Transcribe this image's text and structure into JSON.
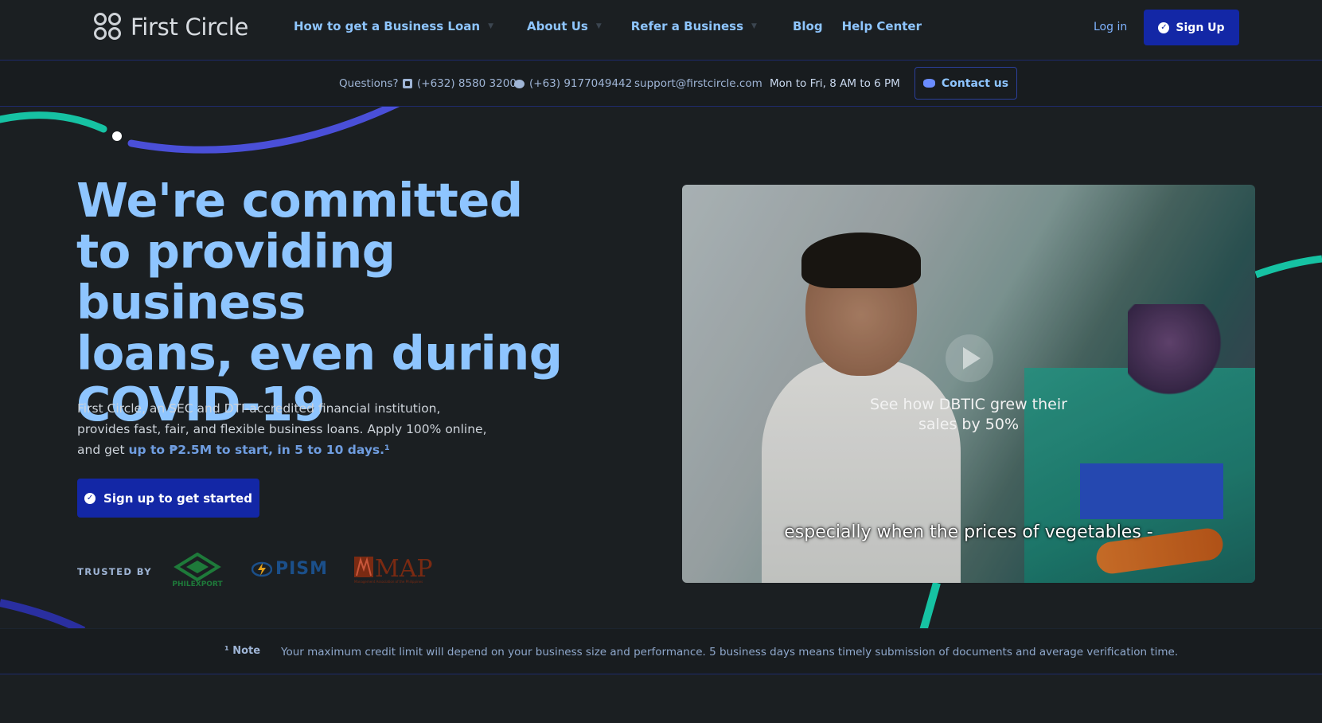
{
  "brand": {
    "name": "First Circle"
  },
  "nav": {
    "items": [
      {
        "label": "How to get a Business Loan",
        "has_dropdown": true
      },
      {
        "label": "About Us",
        "has_dropdown": true
      },
      {
        "label": "Refer a Business",
        "has_dropdown": true
      },
      {
        "label": "Blog",
        "has_dropdown": false
      },
      {
        "label": "Help Center",
        "has_dropdown": false
      }
    ],
    "login_label": "Log in",
    "signup_label": "Sign Up"
  },
  "contact": {
    "questions_label": "Questions?",
    "phone": "(+632) 8580 3200",
    "mobile": "(+63) 9177049442",
    "email": "support@firstcircle.com",
    "hours": "Mon to Fri, 8 AM to 6 PM",
    "contact_button_label": "Contact us"
  },
  "hero": {
    "title_lines": [
      "We're committed",
      "to providing business",
      "loans, even during",
      "COVID-19"
    ],
    "description_prefix": "First Circle, an SEC and DTI-accredited financial institution, provides fast, fair, and flexible business loans. Apply 100% online, and get ",
    "description_highlight": "up to ₱2.5M to start, in 5 to 10 days.¹",
    "cta_label": "Sign up to get started"
  },
  "trusted": {
    "label": "TRUSTED BY",
    "logos": [
      "PHILEXPORT",
      "PISM",
      "MAP"
    ],
    "map_subtext": "Management Association of the Philippines"
  },
  "video": {
    "caption": "See how DBTIC grew their sales by 50%",
    "subtitle": "especially when the prices of vegetables -"
  },
  "note": {
    "label": "¹ Note",
    "text": "Your maximum credit limit will depend on your business size and performance. 5 business days means timely submission of documents and average verification time."
  },
  "colors": {
    "background": "#1b1f22",
    "accent_blue": "#8ec5ff",
    "primary_button": "#1327a6",
    "teal_arc": "#16c2a3",
    "indigo_arc": "#4a4fd8"
  }
}
